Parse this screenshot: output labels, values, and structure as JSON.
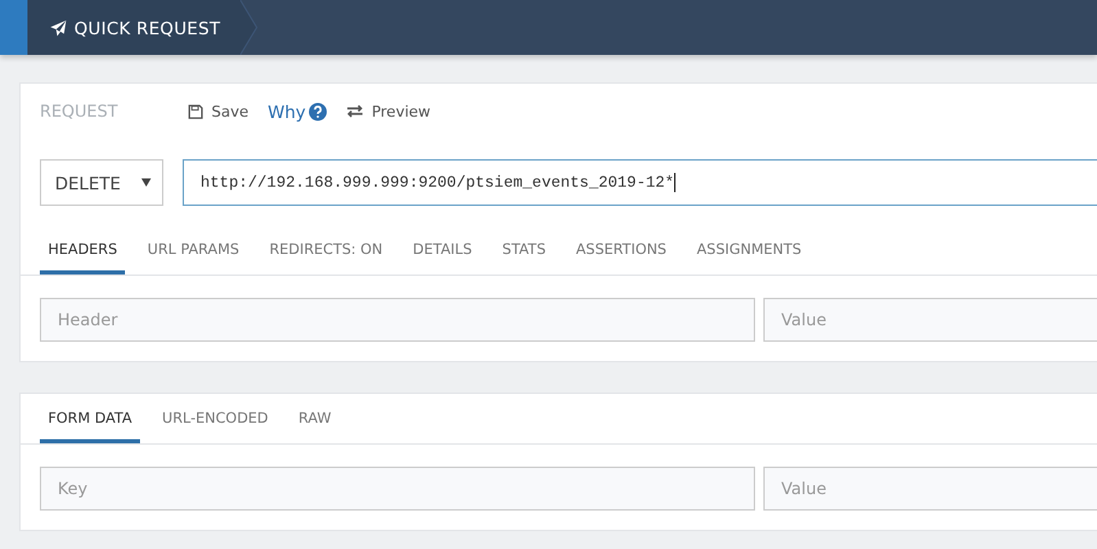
{
  "topbar": {
    "title": "QUICK REQUEST"
  },
  "request": {
    "label": "REQUEST",
    "actions": [
      {
        "kind": "save",
        "label": "Save"
      },
      {
        "kind": "why",
        "label": "Why"
      },
      {
        "kind": "preview",
        "label": "Preview"
      }
    ],
    "method": "DELETE",
    "url": "http://192.168.999.999:9200/ptsiem_events_2019-12*",
    "tabs": [
      {
        "label": "HEADERS",
        "selected": true
      },
      {
        "label": "URL PARAMS",
        "selected": false
      },
      {
        "label": "REDIRECTS: ON",
        "selected": false
      },
      {
        "label": "DETAILS",
        "selected": false
      },
      {
        "label": "STATS",
        "selected": false
      },
      {
        "label": "ASSERTIONS",
        "selected": false
      },
      {
        "label": "ASSIGNMENTS",
        "selected": false
      }
    ],
    "fields": [
      {
        "placeholder": "Header"
      },
      {
        "placeholder": "Value"
      }
    ]
  },
  "body": {
    "tabs": [
      {
        "label": "FORM DATA",
        "selected": true
      },
      {
        "label": "URL-ENCODED",
        "selected": false
      },
      {
        "label": "RAW",
        "selected": false
      }
    ],
    "fields": [
      {
        "placeholder": "Key"
      },
      {
        "placeholder": "Value"
      }
    ]
  }
}
